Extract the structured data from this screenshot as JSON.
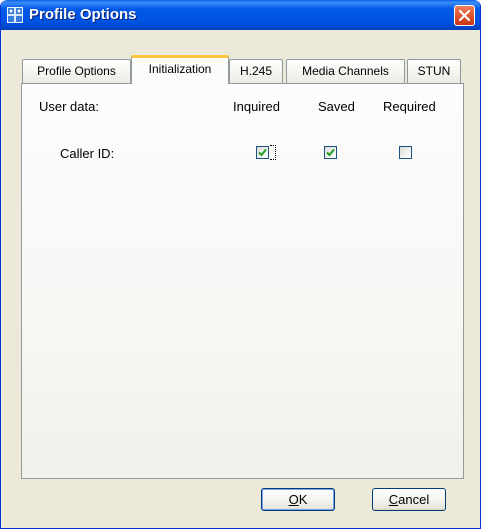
{
  "window": {
    "title": "Profile Options"
  },
  "tabs": [
    {
      "label": "Profile Options",
      "active": false
    },
    {
      "label": "Initialization",
      "active": true
    },
    {
      "label": "H.245",
      "active": false
    },
    {
      "label": "Media Channels",
      "active": false
    },
    {
      "label": "STUN",
      "active": false
    }
  ],
  "panel": {
    "row_header": "User data:",
    "columns": [
      "Inquired",
      "Saved",
      "Required"
    ],
    "rows": [
      {
        "label": "Caller ID:",
        "inquired": true,
        "saved": true,
        "required": false
      }
    ]
  },
  "buttons": {
    "ok": {
      "mnemonic": "O",
      "rest": "K"
    },
    "cancel": {
      "mnemonic": "C",
      "rest": "ancel"
    }
  },
  "colors": {
    "titlebar": "#0054e3",
    "check": "#21a121",
    "active_tab_accent": "#ffc83c",
    "close": "#e0542c"
  }
}
